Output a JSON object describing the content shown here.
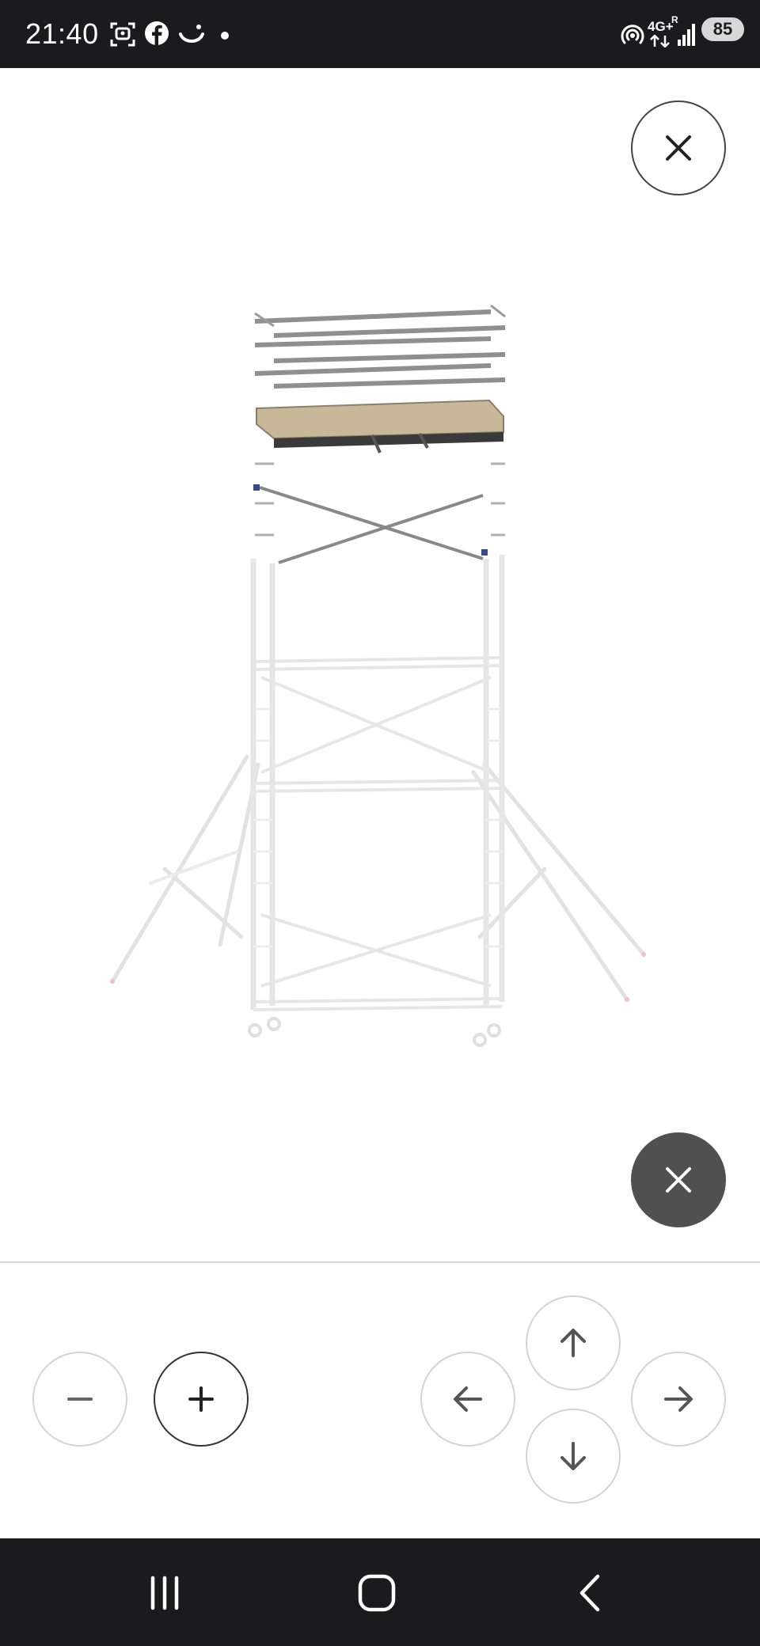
{
  "status_bar": {
    "time": "21:40",
    "network_label": "4G+",
    "roaming_label": "R",
    "battery_level": "85",
    "left_icons": [
      "screenshot-icon",
      "facebook-icon",
      "smile-icon",
      "dot-icon"
    ],
    "right_icons": [
      "hotspot-icon",
      "network-4g-icon",
      "signal-icon",
      "battery-icon"
    ]
  },
  "viewer": {
    "close_icon": "close-icon",
    "image_subject": "mobile-scaffold-tower-icon",
    "overlay_close_icon": "close-icon"
  },
  "controls": {
    "zoom_out_icon": "minus-icon",
    "zoom_in_icon": "plus-icon",
    "pan_up_icon": "arrow-up-icon",
    "pan_left_icon": "arrow-left-icon",
    "pan_right_icon": "arrow-right-icon",
    "pan_down_icon": "arrow-down-icon"
  },
  "nav_bar": {
    "recents_icon": "recents-icon",
    "home_icon": "home-icon",
    "back_icon": "back-icon"
  },
  "colors": {
    "system_bar": "#1b1b1d",
    "dark_button": "#505050",
    "button_border_light": "#d4d4d4",
    "button_border_strong": "#333333",
    "platform_wood": "#c8b89a"
  }
}
